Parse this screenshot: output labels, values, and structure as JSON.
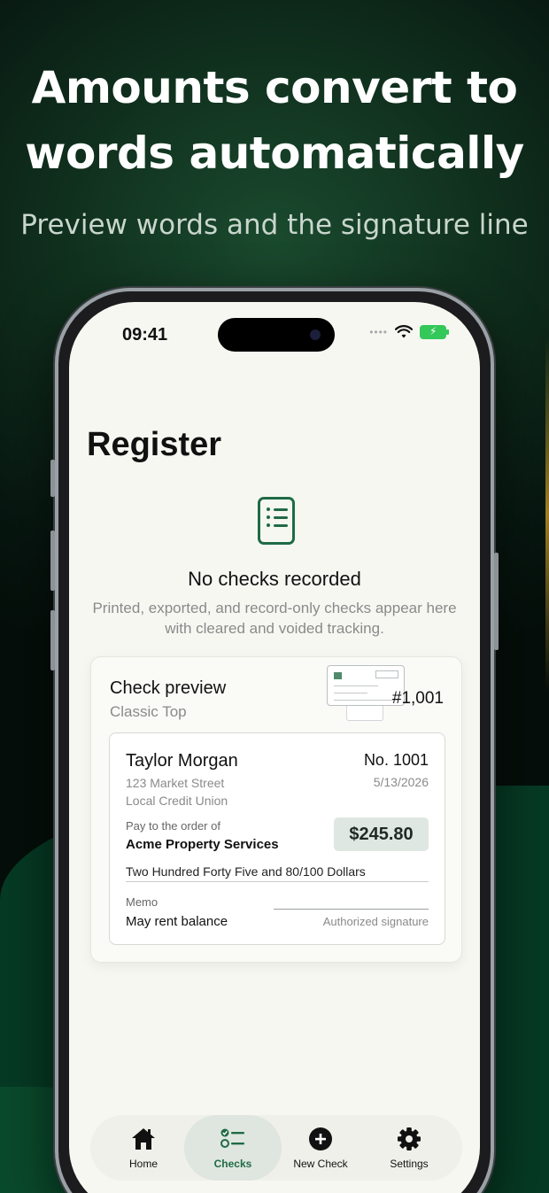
{
  "promo": {
    "headline_line1": "Amounts convert to",
    "headline_line2": "words automatically",
    "subheadline": "Preview words and the signature line"
  },
  "status_bar": {
    "time": "09:41"
  },
  "screen": {
    "title": "Register",
    "empty_state": {
      "icon": "list-document-icon",
      "title": "No checks recorded",
      "description": "Printed, exported, and record-only checks appear here with cleared and voided tracking."
    },
    "preview_card": {
      "title": "Check preview",
      "style_name": "Classic Top",
      "number_label": "#1,001",
      "check": {
        "payer_name": "Taylor Morgan",
        "payer_address": "123 Market Street",
        "bank_name": "Local Credit Union",
        "check_number": "No. 1001",
        "date": "5/13/2026",
        "pay_to_label": "Pay to the order of",
        "payee": "Acme Property Services",
        "amount": "$245.80",
        "amount_words": "Two Hundred Forty Five and 80/100 Dollars",
        "memo_label": "Memo",
        "memo": "May rent balance",
        "signature_label": "Authorized signature"
      }
    }
  },
  "tab_bar": {
    "tabs": [
      {
        "label": "Home",
        "icon": "home-icon"
      },
      {
        "label": "Checks",
        "icon": "checklist-icon",
        "active": true
      },
      {
        "label": "New Check",
        "icon": "plus-circle-icon"
      },
      {
        "label": "Settings",
        "icon": "gear-icon"
      }
    ]
  },
  "colors": {
    "accent": "#1f6b45",
    "background": "#0f2d1c",
    "screen": "#f7f7f2",
    "amount_bg": "#dfe7e2"
  }
}
